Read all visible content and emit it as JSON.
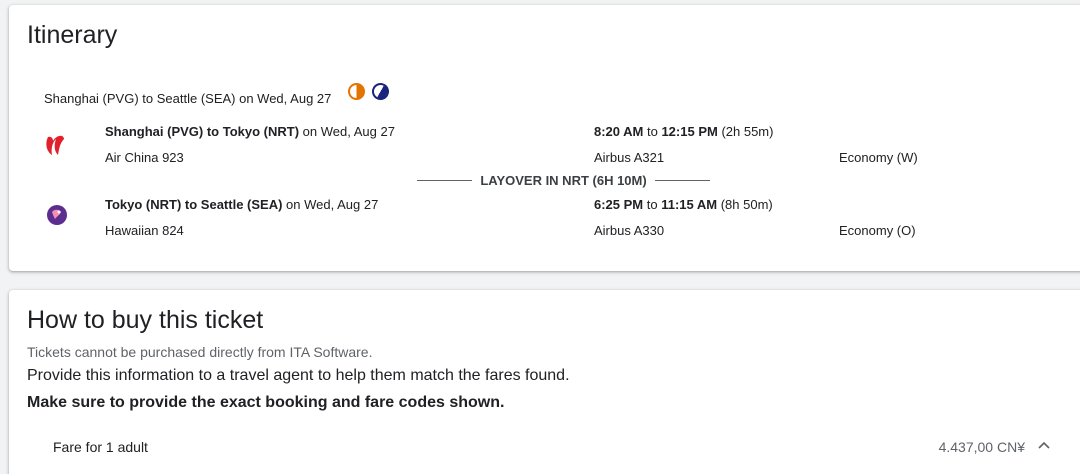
{
  "itinerary": {
    "title": "Itinerary",
    "trip_summary": "Shanghai (PVG) to Seattle (SEA) on Wed, Aug 27",
    "icons": [
      "sun-icon",
      "moon-icon"
    ],
    "segments": [
      {
        "route": "Shanghai (PVG) to Tokyo (NRT)",
        "date_text": " on Wed, Aug 27",
        "depart": "8:20 AM",
        "to": " to ",
        "arrive": "12:15 PM",
        "duration": " (2h 55m)",
        "flight": "Air China 923",
        "aircraft": "Airbus A321",
        "cabin": "Economy (W)",
        "logo": "air-china-logo",
        "logo_color": "#e0202a"
      },
      {
        "route": "Tokyo (NRT) to Seattle (SEA)",
        "date_text": " on Wed, Aug 27",
        "depart": "6:25 PM",
        "to": " to ",
        "arrive": "11:15 AM",
        "duration": " (8h 50m)",
        "flight": "Hawaiian 824",
        "aircraft": "Airbus A330",
        "cabin": "Economy (O)",
        "logo": "hawaiian-logo",
        "logo_color": "#5c2d91"
      }
    ],
    "layover": "LAYOVER IN NRT (6H 10M)"
  },
  "buy": {
    "title": "How to buy this ticket",
    "note": "Tickets cannot be purchased directly from ITA Software.",
    "instruction": "Provide this information to a travel agent to help them match the fares found.",
    "emphasis": "Make sure to provide the exact booking and fare codes shown.",
    "fare_label": "Fare for 1 adult",
    "fare_price": "4.437,00 CN¥"
  }
}
